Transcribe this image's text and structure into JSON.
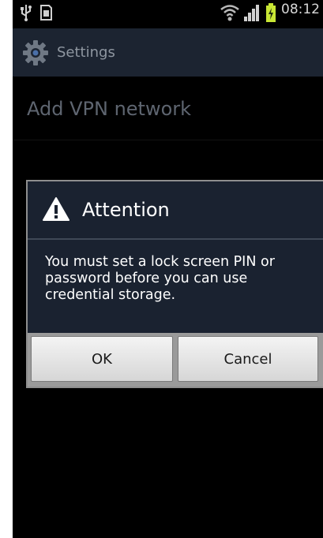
{
  "status_bar": {
    "time": "08:12",
    "icons": [
      "usb-icon",
      "sd-card-icon",
      "wifi-icon",
      "signal-icon",
      "battery-charging-icon"
    ],
    "battery_color": "#c8e635"
  },
  "titlebar": {
    "title": "Settings",
    "icon": "gear-icon"
  },
  "content": {
    "heading": "Add VPN network"
  },
  "dialog": {
    "icon": "warning-icon",
    "title": "Attention",
    "message": "You must set a lock screen PIN or password before you can use credential storage.",
    "buttons": {
      "ok": "OK",
      "cancel": "Cancel"
    }
  }
}
